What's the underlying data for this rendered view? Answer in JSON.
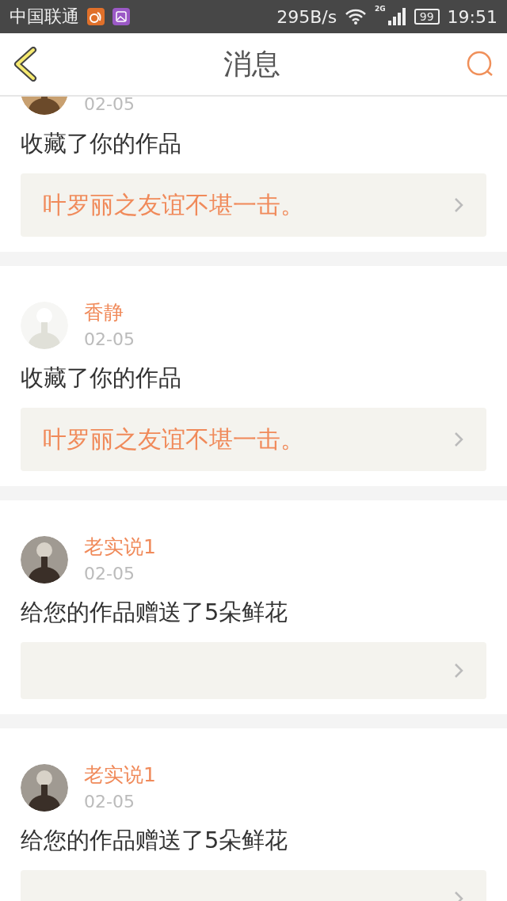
{
  "status_bar": {
    "carrier": "中国联通",
    "speed": "295B/s",
    "network": "2G",
    "battery": "99",
    "time": "19:51"
  },
  "header": {
    "title": "消息"
  },
  "messages": [
    {
      "date": "02-05",
      "action": "收藏了你的作品",
      "work_title": "叶罗丽之友谊不堪一击。"
    },
    {
      "name": "香静",
      "date": "02-05",
      "action": "收藏了你的作品",
      "work_title": "叶罗丽之友谊不堪一击。"
    },
    {
      "name": "老实说1",
      "date": "02-05",
      "action": "给您的作品赠送了5朵鲜花"
    },
    {
      "name": "老实说1",
      "date": "02-05",
      "action": "给您的作品赠送了5朵鲜花"
    }
  ]
}
